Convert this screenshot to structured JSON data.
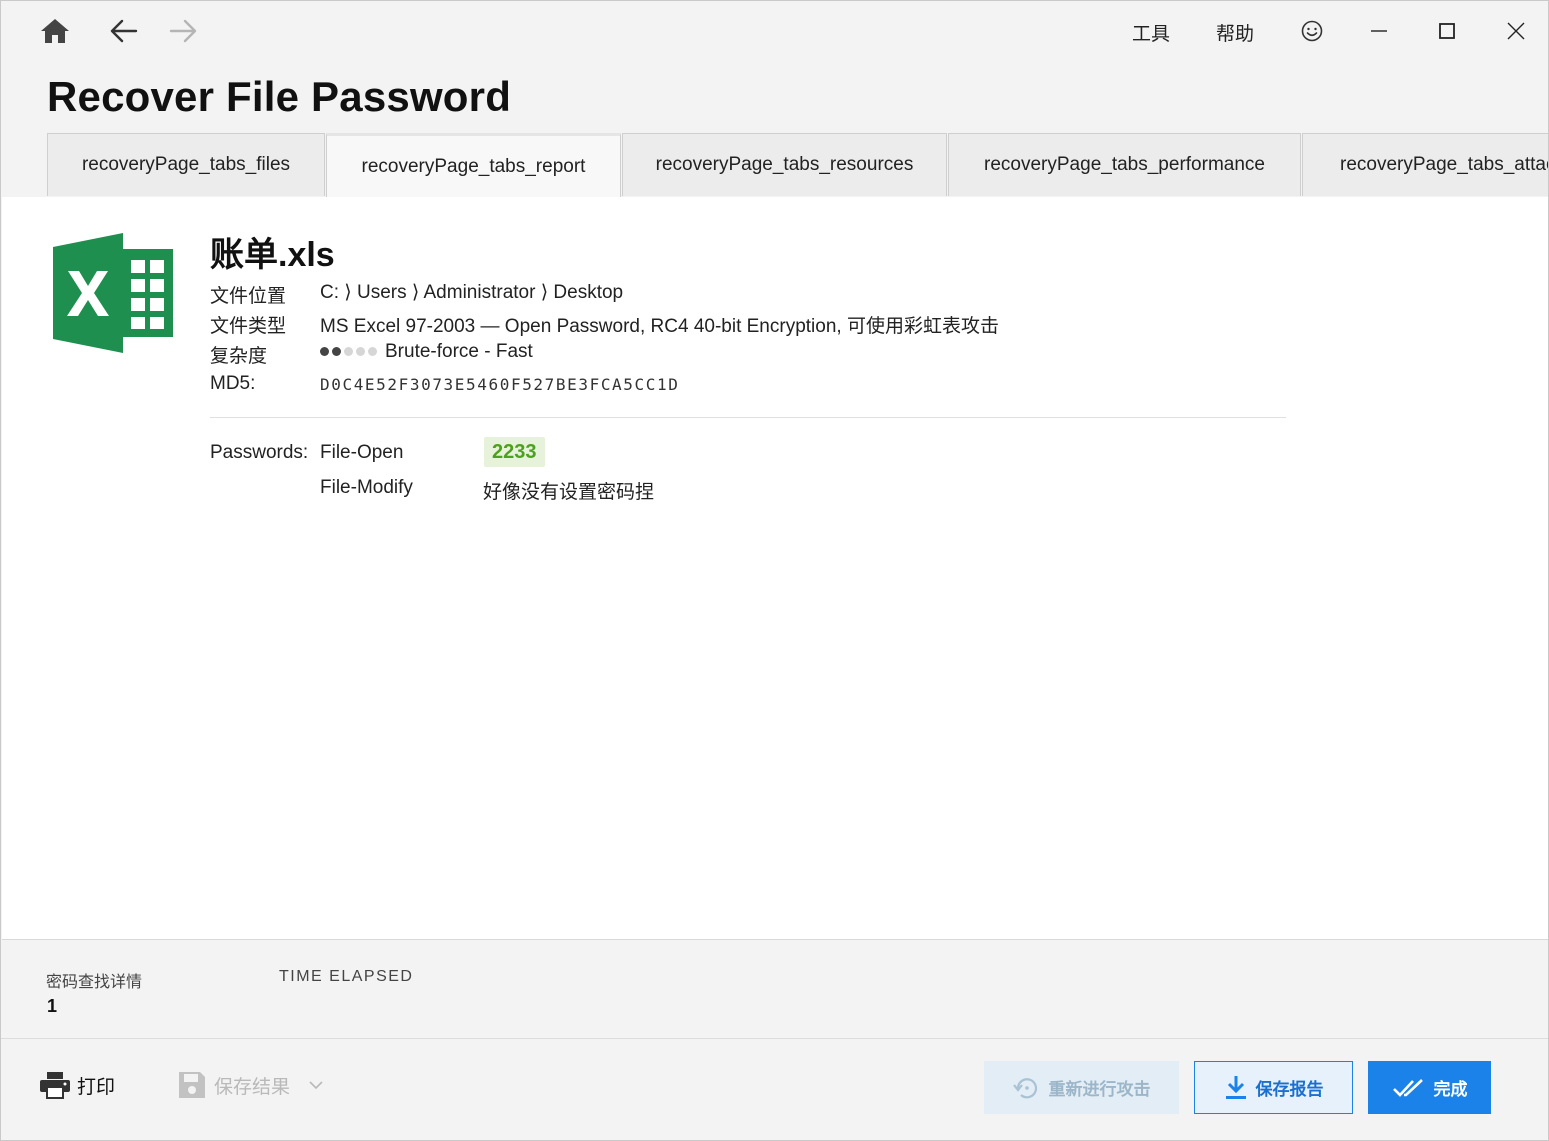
{
  "nav": {
    "home_icon": "home-icon",
    "back_icon": "arrow-left-icon",
    "forward_icon": "arrow-right-icon"
  },
  "menu": {
    "tools": "工具",
    "help": "帮助",
    "feedback_icon": "smiley-icon"
  },
  "window_controls": [
    "minimize-icon",
    "maximize-icon",
    "close-icon"
  ],
  "page_title": "Recover File Password",
  "tabs": [
    {
      "label": "recoveryPage_tabs_files",
      "active": false
    },
    {
      "label": "recoveryPage_tabs_report",
      "active": true
    },
    {
      "label": "recoveryPage_tabs_resources",
      "active": false
    },
    {
      "label": "recoveryPage_tabs_performance",
      "active": false
    },
    {
      "label": "recoveryPage_tabs_attac",
      "active": false
    }
  ],
  "report": {
    "file_icon": "excel-icon",
    "file_name": "账单.xls",
    "location_label": "文件位置",
    "location_value": "C: ⟩ Users ⟩ Administrator ⟩ Desktop",
    "type_label": "文件类型",
    "type_value": "MS Excel 97-2003 — Open Password, RC4 40-bit Encryption, 可使用彩虹表攻击",
    "complexity_label": "复杂度",
    "complexity_level": 2,
    "complexity_max": 5,
    "complexity_value": "Brute-force - Fast",
    "md5_label": "MD5:",
    "md5_value": "D0C4E52F3073E5460F527BE3FCA5CC1D",
    "passwords_label": "Passwords:",
    "file_open_label": "File-Open",
    "file_open_value": "2233",
    "file_modify_label": "File-Modify",
    "file_modify_value": "好像没有设置密码捏"
  },
  "status": {
    "details_label": "密码查找详情",
    "details_value": "1",
    "time_label": "TIME ELAPSED"
  },
  "footer": {
    "print_label": "打印",
    "print_icon": "printer-icon",
    "save_result_label": "保存结果",
    "save_result_icon": "floppy-disk-icon",
    "retry_label": "重新进行攻击",
    "retry_icon": "restart-icon",
    "save_report_label": "保存报告",
    "save_report_icon": "download-icon",
    "done_label": "完成",
    "done_icon": "double-check-icon"
  },
  "colors": {
    "accent": "#1a82e8",
    "password_green": "#4ea01f",
    "password_bg": "#e6f2d9",
    "excel_green": "#1e8f4e"
  }
}
